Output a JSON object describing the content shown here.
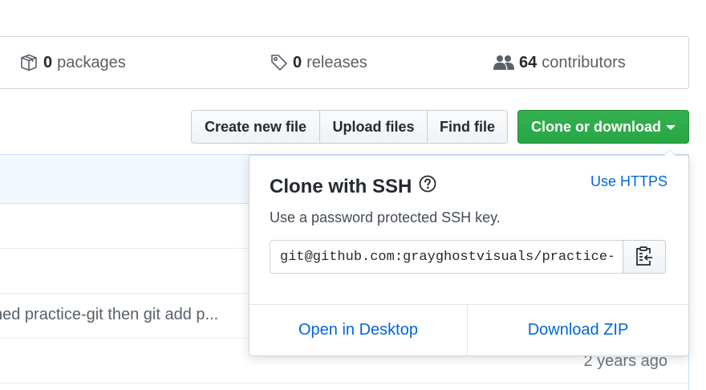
{
  "stats": {
    "packages": {
      "count": "0",
      "label": "packages",
      "icon": "package-icon"
    },
    "releases": {
      "count": "0",
      "label": "releases",
      "icon": "tag-icon"
    },
    "contributors": {
      "count": "64",
      "label": "contributors",
      "icon": "people-icon"
    }
  },
  "actions": {
    "create_new_file": "Create new file",
    "upload_files": "Upload files",
    "find_file": "Find file",
    "clone_or_download": "Clone or download"
  },
  "file_list": {
    "commit_message": "ned practice-git then git add p...",
    "age": "2 years ago"
  },
  "clone_dropdown": {
    "title": "Clone with SSH",
    "switch_protocol": "Use HTTPS",
    "description": "Use a password protected SSH key.",
    "url": "git@github.com:grayghostvisuals/practice-git.git",
    "copy_icon": "clipboard-icon",
    "open_in_desktop": "Open in Desktop",
    "download_zip": "Download ZIP"
  },
  "colors": {
    "primary_green": "#28a745",
    "link_blue": "#0366d6",
    "border_gray": "#d1d5da"
  }
}
